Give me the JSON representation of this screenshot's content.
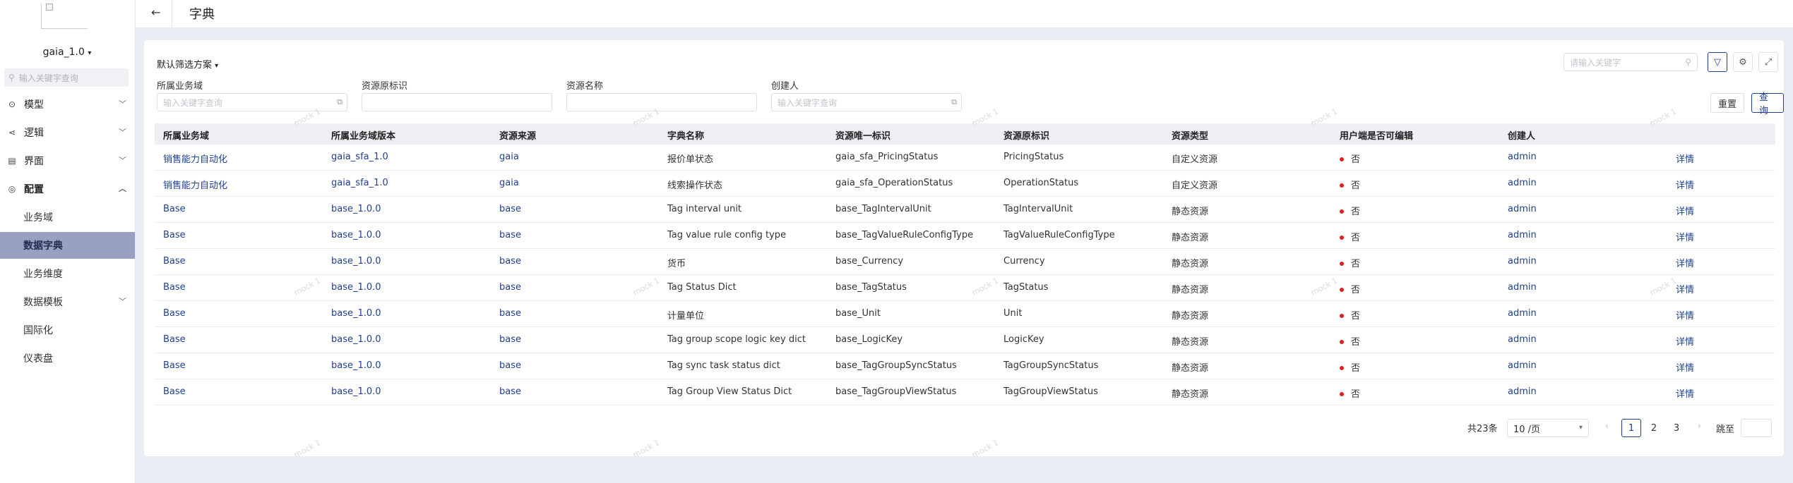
{
  "sidebar": {
    "app_name": "gaia_1.0",
    "search_placeholder": "输入关键字查询",
    "nav": {
      "model": "模型",
      "logic": "逻辑",
      "interface": "界面",
      "config": "配置",
      "sub": {
        "business_domain": "业务域",
        "data_dictionary": "数据字典",
        "business_dimension": "业务维度",
        "data_template": "数据模板",
        "i18n": "国际化",
        "dashboard": "仪表盘"
      }
    }
  },
  "header": {
    "back_icon": "←",
    "title": "字典"
  },
  "toolbar": {
    "scheme_label": "默认筛选方案",
    "keyword_placeholder": "请输入关键字"
  },
  "filters": {
    "domain_label": "所属业务域",
    "domain_placeholder": "输入关键字查询",
    "resource_id_label": "资源原标识",
    "resource_name_label": "资源名称",
    "creator_label": "创建人",
    "creator_placeholder": "输入关键字查询",
    "reset_label": "重置",
    "query_label": "查询"
  },
  "table": {
    "headers": [
      "所属业务域",
      "所属业务域版本",
      "资源来源",
      "字典名称",
      "资源唯一标识",
      "资源原标识",
      "资源类型",
      "用户端是否可编辑",
      "创建人"
    ],
    "rows": [
      [
        "销售能力自动化",
        "gaia_sfa_1.0",
        "gaia",
        "报价单状态",
        "gaia_sfa_PricingStatus",
        "PricingStatus",
        "自定义资源",
        "否",
        "admin",
        "详情"
      ],
      [
        "销售能力自动化",
        "gaia_sfa_1.0",
        "gaia",
        "线索操作状态",
        "gaia_sfa_OperationStatus",
        "OperationStatus",
        "自定义资源",
        "否",
        "admin",
        "详情"
      ],
      [
        "Base",
        "base_1.0.0",
        "base",
        "Tag interval unit",
        "base_TagIntervalUnit",
        "TagIntervalUnit",
        "静态资源",
        "否",
        "admin",
        "详情"
      ],
      [
        "Base",
        "base_1.0.0",
        "base",
        "Tag value rule config type",
        "base_TagValueRuleConfigType",
        "TagValueRuleConfigType",
        "静态资源",
        "否",
        "admin",
        "详情"
      ],
      [
        "Base",
        "base_1.0.0",
        "base",
        "货币",
        "base_Currency",
        "Currency",
        "静态资源",
        "否",
        "admin",
        "详情"
      ],
      [
        "Base",
        "base_1.0.0",
        "base",
        "Tag Status Dict",
        "base_TagStatus",
        "TagStatus",
        "静态资源",
        "否",
        "admin",
        "详情"
      ],
      [
        "Base",
        "base_1.0.0",
        "base",
        "计量单位",
        "base_Unit",
        "Unit",
        "静态资源",
        "否",
        "admin",
        "详情"
      ],
      [
        "Base",
        "base_1.0.0",
        "base",
        "Tag group scope logic key dict",
        "base_LogicKey",
        "LogicKey",
        "静态资源",
        "否",
        "admin",
        "详情"
      ],
      [
        "Base",
        "base_1.0.0",
        "base",
        "Tag sync task status dict",
        "base_TagGroupSyncStatus",
        "TagGroupSyncStatus",
        "静态资源",
        "否",
        "admin",
        "详情"
      ],
      [
        "Base",
        "base_1.0.0",
        "base",
        "Tag Group View Status Dict",
        "base_TagGroupViewStatus",
        "TagGroupViewStatus",
        "静态资源",
        "否",
        "admin",
        "详情"
      ]
    ]
  },
  "pagination": {
    "total": "共23条",
    "page_size": "10 /页",
    "pages": [
      "1",
      "2",
      "3"
    ],
    "current": "1",
    "prev": "‹",
    "next": "›",
    "jump_label": "跳至"
  },
  "watermark": "mock 1",
  "colors": {
    "accent": "#1f3f8f",
    "active_nav": "#98a2c0",
    "status_dot": "#e02020"
  }
}
